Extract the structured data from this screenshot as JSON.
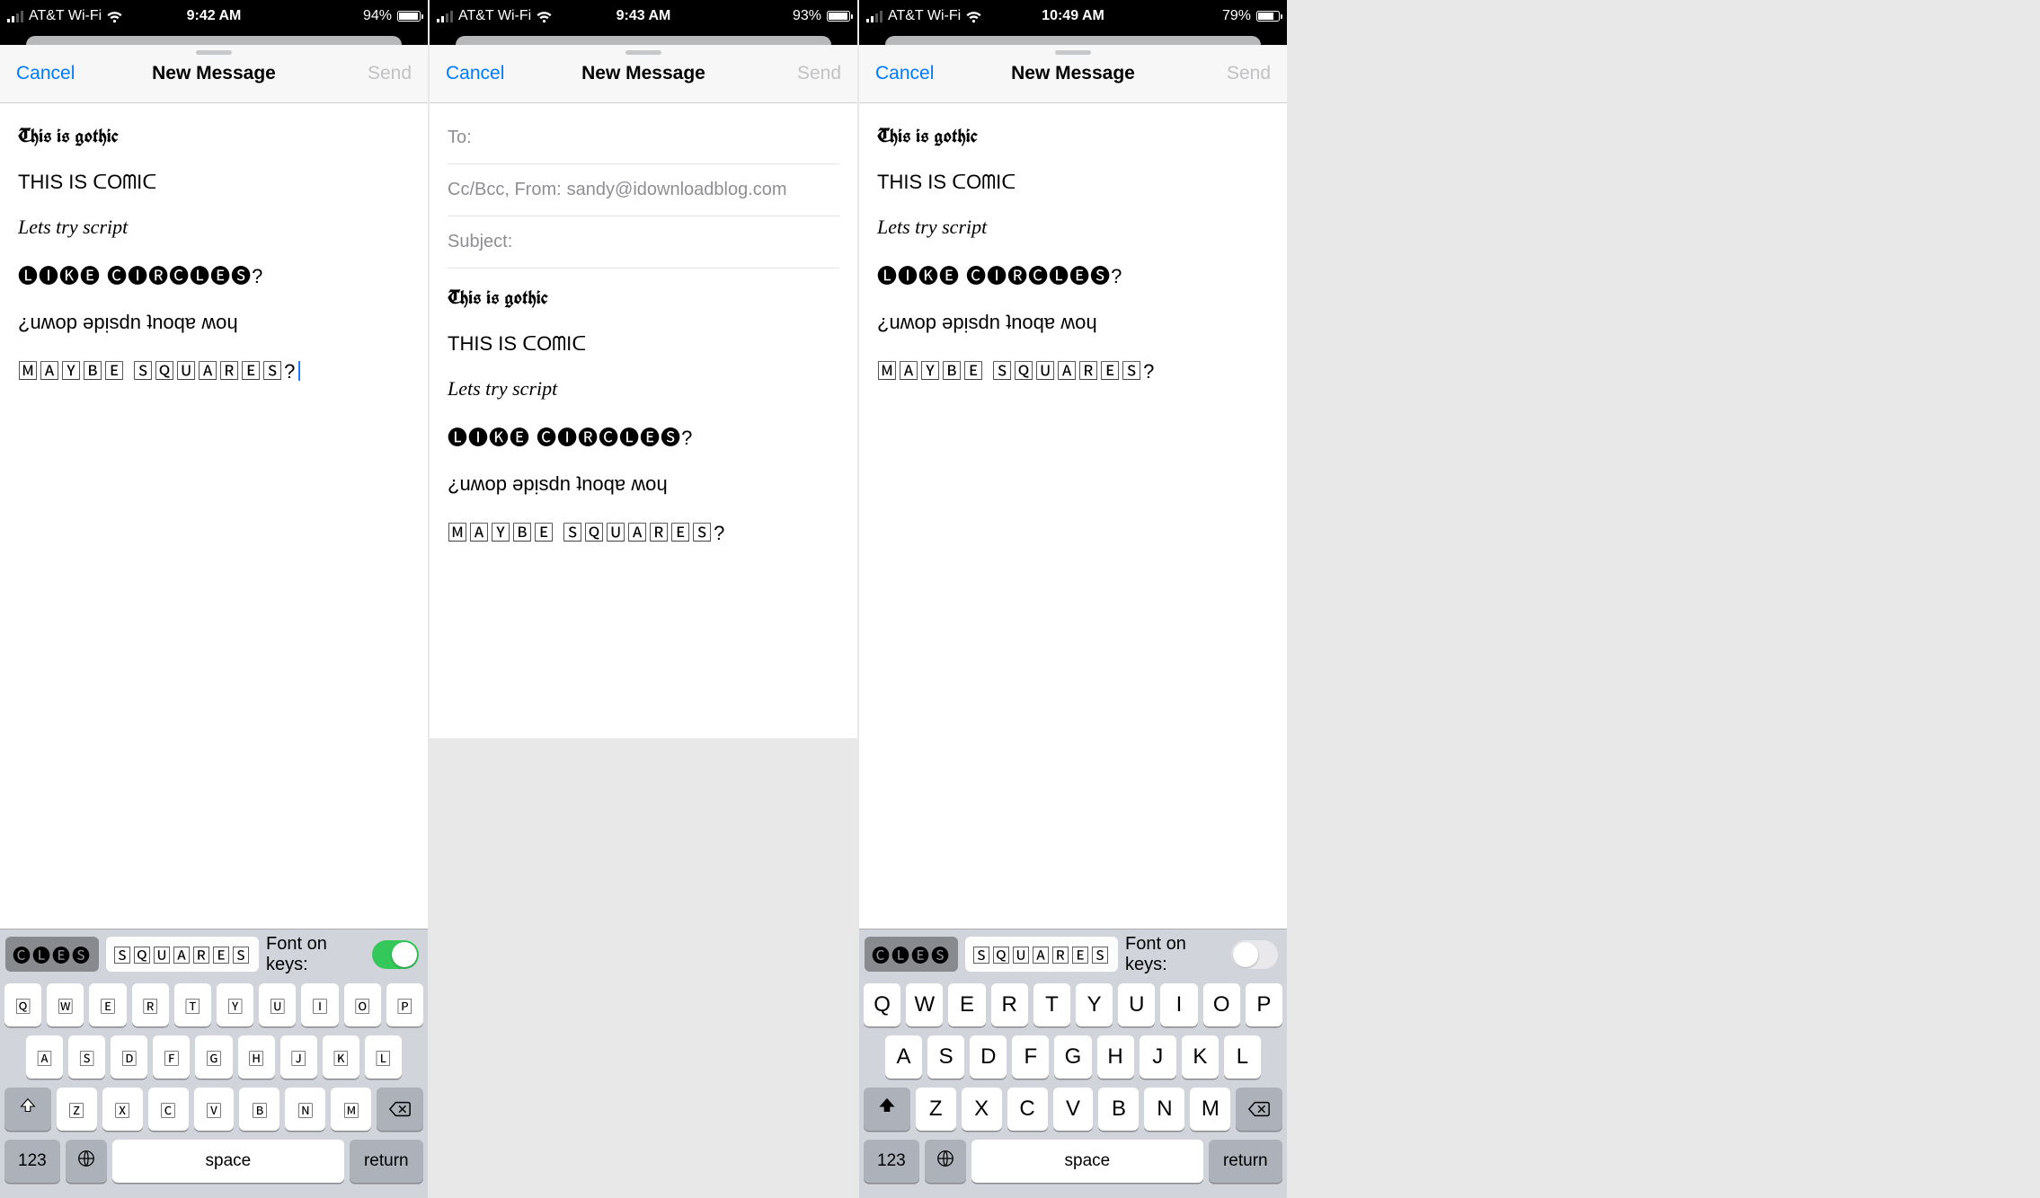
{
  "screens": [
    {
      "status": {
        "carrier": "AT&T Wi-Fi",
        "time": "9:42 AM",
        "battery_pct": "94%",
        "battery_fill_pct": 94,
        "signal_bars_on": 2
      },
      "header": {
        "cancel": "Cancel",
        "title": "New Message",
        "send": "Send"
      },
      "body_mode": "lines_with_cursor",
      "lines": {
        "gothic": "This is gothic",
        "comic": "THIS IS ᑕOᗰIᑕ",
        "script": "Lets try script",
        "circles": "🅛🅘🅚🅔 🅒🅘🅡🅒🅛🅔🅢?",
        "upside": "¿uʍop ǝpᴉsdn ʇnoqɐ ʍoɥ",
        "squares": "🄼🄰🅈🄱🄴 🅂🅀🅄🄰🅁🄴🅂?"
      },
      "keyboard": {
        "visible": true,
        "suggestions": {
          "chip1": "🅒🅛🅔🅢",
          "chip2": "🅂🅀🅄🄰🅁🄴🅂"
        },
        "toggle_label": "Font on keys:",
        "toggle_on": true,
        "keys_style": "squared",
        "rows": {
          "r1": [
            "🅀",
            "🅆",
            "🄴",
            "🅁",
            "🅃",
            "🅈",
            "🅄",
            "🄸",
            "🄾",
            "🄿"
          ],
          "r2": [
            "🄰",
            "🅂",
            "🄳",
            "🄵",
            "🄶",
            "🄷",
            "🄹",
            "🄺",
            "🄻"
          ],
          "r3": [
            "🅉",
            "🅇",
            "🄲",
            "🅅",
            "🄱",
            "🄽",
            "🄼"
          ]
        },
        "bottom": {
          "num": "123",
          "space": "space",
          "ret": "return"
        }
      }
    },
    {
      "status": {
        "carrier": "AT&T Wi-Fi",
        "time": "9:43 AM",
        "battery_pct": "93%",
        "battery_fill_pct": 93,
        "signal_bars_on": 2
      },
      "header": {
        "cancel": "Cancel",
        "title": "New Message",
        "send": "Send"
      },
      "body_mode": "fields_and_lines",
      "fields": {
        "to_label": "To:",
        "cc_label": "Cc/Bcc, From:",
        "cc_value": "sandy@idownloadblog.com",
        "subject_label": "Subject:"
      },
      "lines": {
        "gothic": "This is gothic",
        "comic": "THIS IS ᑕOᗰIᑕ",
        "script": "Lets try script",
        "circles": "🅛🅘🅚🅔 🅒🅘🅡🅒🅛🅔🅢?",
        "upside": "¿uʍop ǝpᴉsdn ʇnoqɐ ʍoɥ",
        "squares": "🄼🄰🅈🄱🄴 🅂🅀🅄🄰🅁🄴🅂?"
      },
      "keyboard": {
        "visible": false
      }
    },
    {
      "status": {
        "carrier": "AT&T Wi-Fi",
        "time": "10:49 AM",
        "battery_pct": "79%",
        "battery_fill_pct": 79,
        "signal_bars_on": 2
      },
      "header": {
        "cancel": "Cancel",
        "title": "New Message",
        "send": "Send"
      },
      "body_mode": "lines",
      "lines": {
        "gothic": "This is gothic",
        "comic": "THIS IS ᑕOᗰIᑕ",
        "script": "Lets try script",
        "circles": "🅛🅘🅚🅔 🅒🅘🅡🅒🅛🅔🅢?",
        "upside": "¿uʍop ǝpᴉsdn ʇnoqɐ ʍoɥ",
        "squares": "🄼🄰🅈🄱🄴 🅂🅀🅄🄰🅁🄴🅂?"
      },
      "keyboard": {
        "visible": true,
        "suggestions": {
          "chip1": "🅒🅛🅔🅢",
          "chip2": "🅂🅀🅄🄰🅁🄴🅂"
        },
        "toggle_label": "Font on keys:",
        "toggle_on": false,
        "keys_style": "plain",
        "rows": {
          "r1": [
            "Q",
            "W",
            "E",
            "R",
            "T",
            "Y",
            "U",
            "I",
            "O",
            "P"
          ],
          "r2": [
            "A",
            "S",
            "D",
            "F",
            "G",
            "H",
            "J",
            "K",
            "L"
          ],
          "r3": [
            "Z",
            "X",
            "C",
            "V",
            "B",
            "N",
            "M"
          ]
        },
        "bottom": {
          "num": "123",
          "space": "space",
          "ret": "return"
        }
      }
    }
  ]
}
